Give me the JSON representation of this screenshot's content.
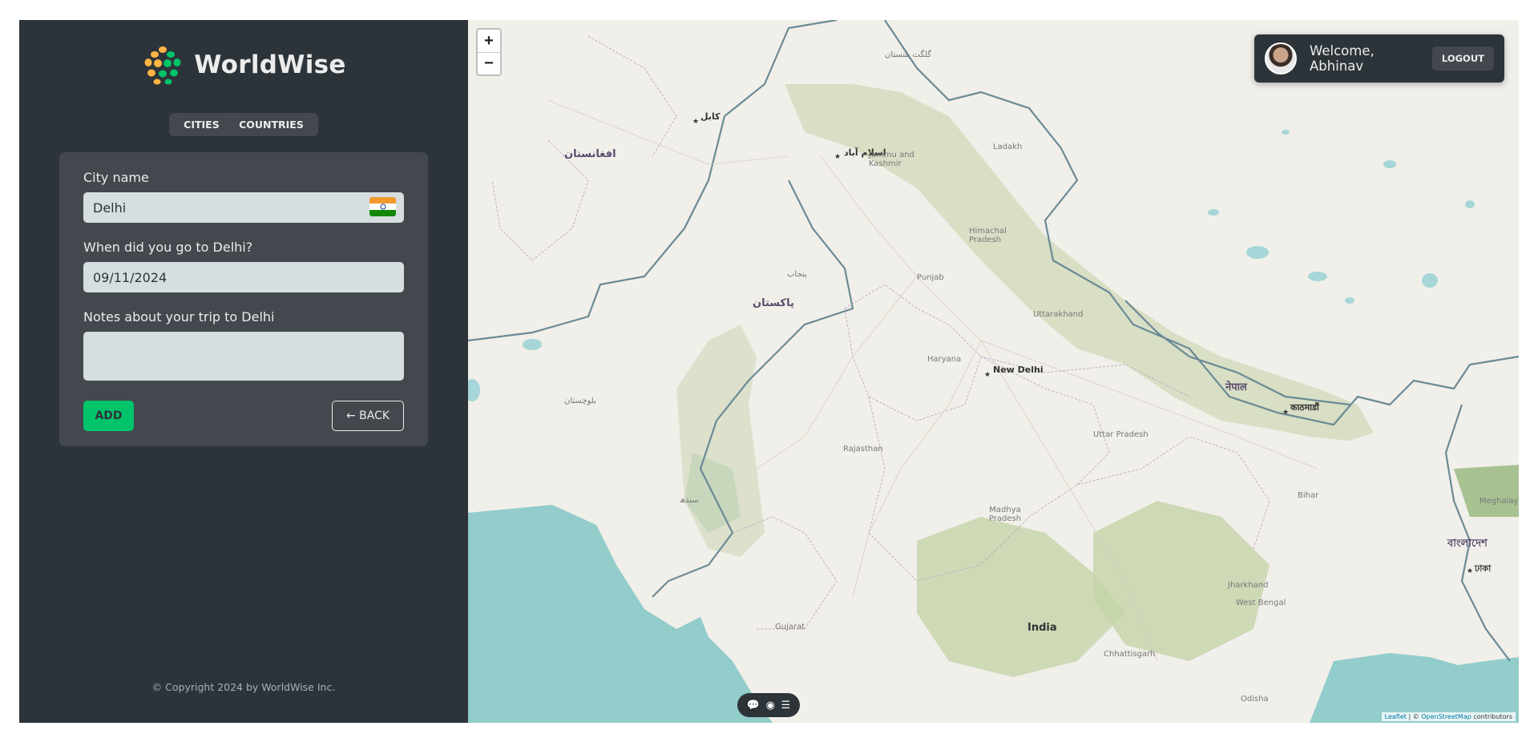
{
  "app": {
    "brand": "WorldWise",
    "copyright": "© Copyright 2024 by WorldWise Inc."
  },
  "nav": {
    "tabs": [
      {
        "label": "CITIES"
      },
      {
        "label": "COUNTRIES"
      }
    ]
  },
  "form": {
    "city_label": "City name",
    "city_value": "Delhi",
    "flag_icon": "flag-india-icon",
    "date_label": "When did you go to Delhi?",
    "date_value": "09/11/2024",
    "notes_label": "Notes about your trip to Delhi",
    "notes_value": "",
    "add_label": "ADD",
    "back_label": "← BACK"
  },
  "user": {
    "welcome": "Welcome, Abhinav",
    "logout_label": "LOGOUT"
  },
  "map": {
    "zoom_in": "+",
    "zoom_out": "−",
    "attribution_leaflet": "Leaflet",
    "attribution_sep": " | © ",
    "attribution_osm": "OpenStreetMap",
    "attribution_tail": " contributors",
    "places": {
      "afghanistan": "افغانستان",
      "pakistan": "پاکستان",
      "islamabad": "اسلام آباد",
      "kabul": "کابل",
      "jammu_kashmir": "Jammu and Kashmir",
      "ladakh": "Ladakh",
      "himachal": "Himachal Pradesh",
      "punjab": "Punjab",
      "uttarakhand": "Uttarakhand",
      "haryana": "Haryana",
      "new_delhi": "New Delhi",
      "rajasthan": "Rajasthan",
      "uttar_pradesh": "Uttar Pradesh",
      "nepal": "नेपाल",
      "kathmandu": "काठमाडौं",
      "bihar": "Bihar",
      "madhya_pradesh": "Madhya Pradesh",
      "gujarat": "Gujarat",
      "india": "India",
      "jharkhand": "Jharkhand",
      "west_bengal": "West Bengal",
      "chhattisgarh": "Chhattisgarh",
      "bangladesh": "বাংলাদেশ",
      "dhaka": "ঢাকা",
      "meghalaya": "Meghalaya",
      "odisha": "Odisha",
      "sindh": "سندھ",
      "balochistan": "بلوچستان",
      "punjab_pk": "پنجاب",
      "gilgit": "گلگت بلتستان"
    }
  }
}
